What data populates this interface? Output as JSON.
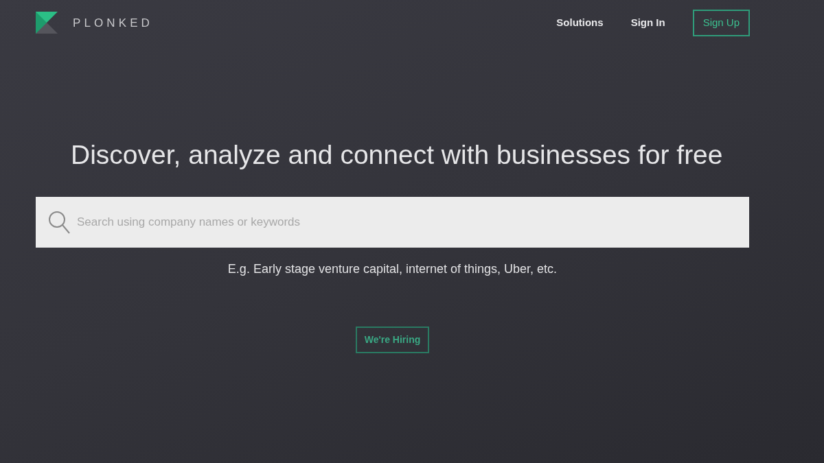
{
  "brand": {
    "name": "PLONKED"
  },
  "nav": [
    {
      "label": "Solutions",
      "kind": "link"
    },
    {
      "label": "Sign In",
      "kind": "link"
    },
    {
      "label": "Sign Up",
      "kind": "button"
    }
  ],
  "hero": {
    "headline": "Discover, analyze and connect with businesses for free"
  },
  "search": {
    "placeholder": "Search using company names or keywords"
  },
  "example": "E.g. Early stage venture capital, internet of things, Uber, etc.",
  "cta": {
    "label": "We're Hiring"
  }
}
